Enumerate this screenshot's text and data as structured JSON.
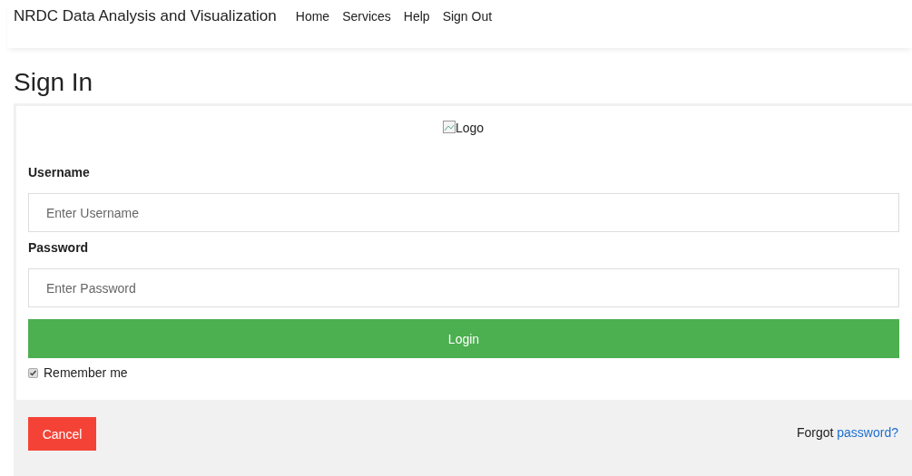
{
  "navbar": {
    "brand": "NRDC Data Analysis and Visualization",
    "links": [
      "Home",
      "Services",
      "Help",
      "Sign Out"
    ]
  },
  "page_title": "Sign In",
  "logo": {
    "alt": "Logo"
  },
  "fields": [
    {
      "label": "Username",
      "placeholder": "Enter Username"
    },
    {
      "label": "Password",
      "placeholder": "Enter Password"
    }
  ],
  "login_button": "Login",
  "remember": {
    "label": "Remember me",
    "checked": true
  },
  "cancel_button": "Cancel",
  "forgot": {
    "text": "Forgot",
    "link": "password?"
  }
}
